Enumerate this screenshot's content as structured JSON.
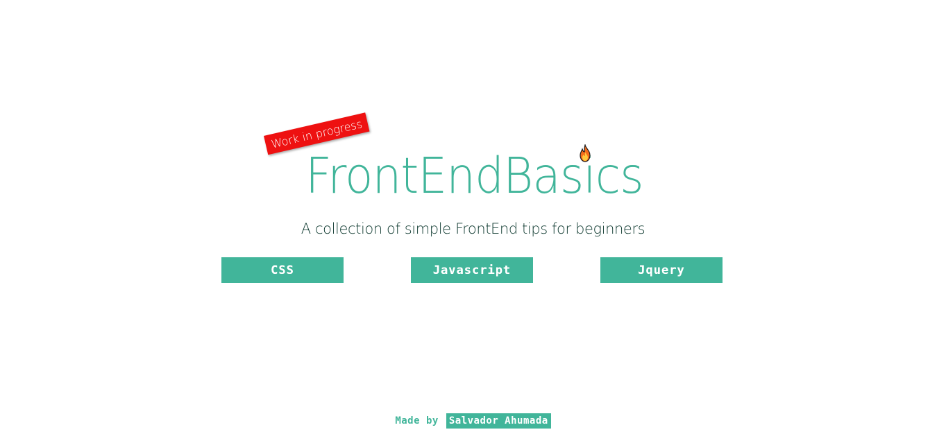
{
  "header": {
    "ribbon_label": "Work in progress",
    "title": "FrontEndBasics",
    "badge_icon": "fire-icon",
    "subtitle": "A collection of simple FrontEnd tips for beginners"
  },
  "nav": {
    "buttons": [
      {
        "label": "CSS"
      },
      {
        "label": "Javascript"
      },
      {
        "label": "Jquery"
      }
    ]
  },
  "footer": {
    "made_by": "Made by",
    "author": "Salvador Ahumada"
  },
  "colors": {
    "accent": "#41b59a",
    "ribbon": "#ee1111",
    "subtitle": "#0f3a30",
    "background": "#ffffff"
  }
}
